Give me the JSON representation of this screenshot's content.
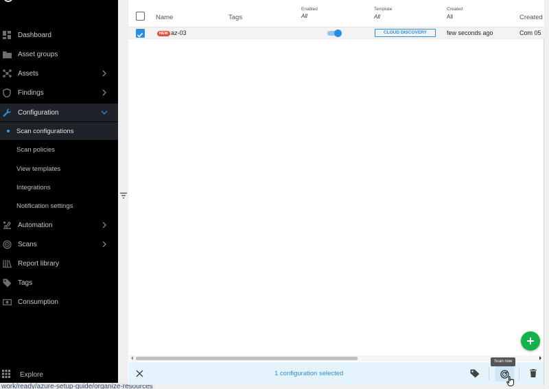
{
  "sidebar": {
    "items": [
      {
        "label": "Dashboard",
        "icon": "dashboard-icon"
      },
      {
        "label": "Asset groups",
        "icon": "folder-icon"
      },
      {
        "label": "Assets",
        "icon": "assets-icon"
      },
      {
        "label": "Findings",
        "icon": "shield-icon"
      },
      {
        "label": "Configuration",
        "icon": "wrench-icon"
      },
      {
        "label": "Automation",
        "icon": "automation-icon"
      },
      {
        "label": "Scans",
        "icon": "radar-icon"
      },
      {
        "label": "Report library",
        "icon": "library-icon"
      },
      {
        "label": "Tags",
        "icon": "tag-icon"
      },
      {
        "label": "Consumption",
        "icon": "consumption-icon"
      }
    ],
    "sub_items": [
      {
        "label": "Scan configurations"
      },
      {
        "label": "Scan policies"
      },
      {
        "label": "View templates"
      },
      {
        "label": "Integrations"
      },
      {
        "label": "Notification settings"
      }
    ],
    "explore_label": "Explore"
  },
  "status_url": "work/ready/azure-setup-guide/organize-resources",
  "table": {
    "columns": {
      "name": "Name",
      "tags": "Tags",
      "enabled": "Enabled",
      "enabled_filter": "All",
      "template": "Template",
      "template_filter": "All",
      "created": "Created",
      "created_filter": "All",
      "created_by": "Created b"
    },
    "rows": [
      {
        "badge": "NEW",
        "name": "az-03",
        "enabled": true,
        "template": "CLOUD DISCOVERY",
        "created": "few seconds ago",
        "created_by": "Com 05"
      }
    ]
  },
  "action_bar": {
    "selected_text": "1 configuration selected",
    "tooltip": "Scan now"
  },
  "colors": {
    "accent": "#2b8ee0",
    "fab": "#14b24c",
    "new_badge": "#e8503a",
    "sidebar_bg": "#000000"
  }
}
